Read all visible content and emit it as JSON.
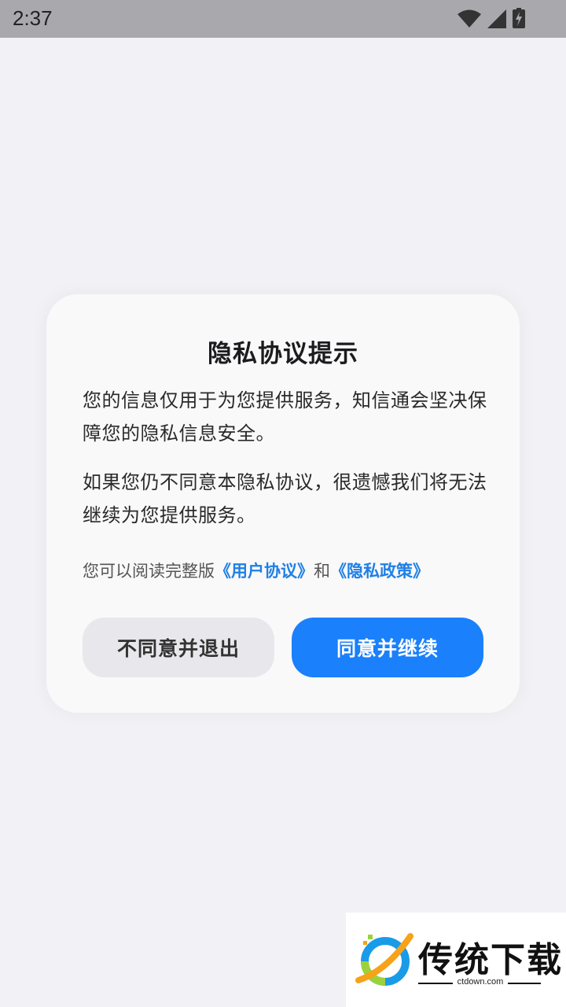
{
  "status_bar": {
    "time": "2:37",
    "icons": [
      "wifi-icon",
      "signal-icon",
      "battery-charging-icon"
    ]
  },
  "dialog": {
    "title": "隐私协议提示",
    "para1": "您的信息仅用于为您提供服务，知信通会坚决保障您的隐私信息安全。",
    "para2": "如果您仍不同意本隐私协议，很遗憾我们将无法继续为您提供服务。",
    "read_prefix": "您可以阅读完整版",
    "user_agreement_link": "《用户协议》",
    "and_text": "和",
    "privacy_policy_link": "《隐私政策》",
    "decline_label": "不同意并退出",
    "accept_label": "同意并继续"
  },
  "watermark": {
    "name": "传统下载",
    "site": "ctdown.com"
  },
  "colors": {
    "accent": "#1a80fb",
    "link": "#1f7fe6",
    "background": "#f2f2f6",
    "statusbar": "#a9a8ad"
  }
}
